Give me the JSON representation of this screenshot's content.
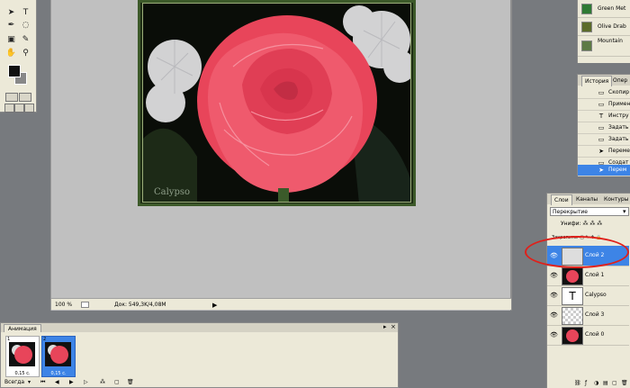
{
  "tools": {
    "icons": [
      "move-tool-icon",
      "text-tool-icon",
      "pen-tool-icon",
      "lasso-tool-icon",
      "crop-tool-icon",
      "eyedropper-tool-icon",
      "hand-tool-icon",
      "zoom-tool-icon",
      "brush-tool-icon",
      "eraser-tool-icon"
    ]
  },
  "document": {
    "watermark": "Calypso",
    "zoom": "100 %",
    "doc_info": "Док: 549,3K/4,08M",
    "colors": {
      "frame": "#3d5a2a",
      "rose": "#e8455a",
      "background": "#0a0d08"
    }
  },
  "animation": {
    "tab": "Анимация",
    "frames": [
      {
        "num": "1",
        "time": "0,15 с.",
        "selected": false
      },
      {
        "num": "2",
        "time": "0,15 с.",
        "selected": true
      }
    ],
    "loop": "Всегда"
  },
  "swatches": {
    "items": [
      {
        "label": "Green Met",
        "color": "#2f7a34"
      },
      {
        "label": "Olive Drab",
        "color": "#5b6b2a"
      },
      {
        "label": "Mountain",
        "color": "#5d7a45"
      }
    ]
  },
  "history": {
    "tabs": [
      "История",
      "Опер"
    ],
    "items": [
      {
        "label": "Скопир",
        "icon": "copy-icon",
        "selected": false
      },
      {
        "label": "Примен",
        "icon": "apply-icon",
        "selected": false
      },
      {
        "label": "Инстру",
        "icon": "text-tool-icon",
        "selected": false
      },
      {
        "label": "Задать",
        "icon": "set-icon",
        "selected": false
      },
      {
        "label": "Задать",
        "icon": "set-icon",
        "selected": false
      },
      {
        "label": "Переме",
        "icon": "move-tool-icon",
        "selected": false
      },
      {
        "label": "Создат",
        "icon": "new-icon",
        "selected": false
      },
      {
        "label": "Перем",
        "icon": "move-tool-icon",
        "selected": true
      }
    ]
  },
  "layers": {
    "tabs": [
      "Слои",
      "Каналы",
      "Контуры"
    ],
    "blend_mode": "Перекрытие",
    "unify_label": "Унифи:",
    "lock_label": "Закрепить:",
    "items": [
      {
        "name": "Слой 2",
        "selected": true,
        "thumb": "blank"
      },
      {
        "name": "Слой 1",
        "selected": false,
        "thumb": "rose"
      },
      {
        "name": "Calypso",
        "selected": false,
        "thumb": "text"
      },
      {
        "name": "Слой 3",
        "selected": false,
        "thumb": "checker"
      },
      {
        "name": "Слой 0",
        "selected": false,
        "thumb": "rose"
      }
    ]
  }
}
